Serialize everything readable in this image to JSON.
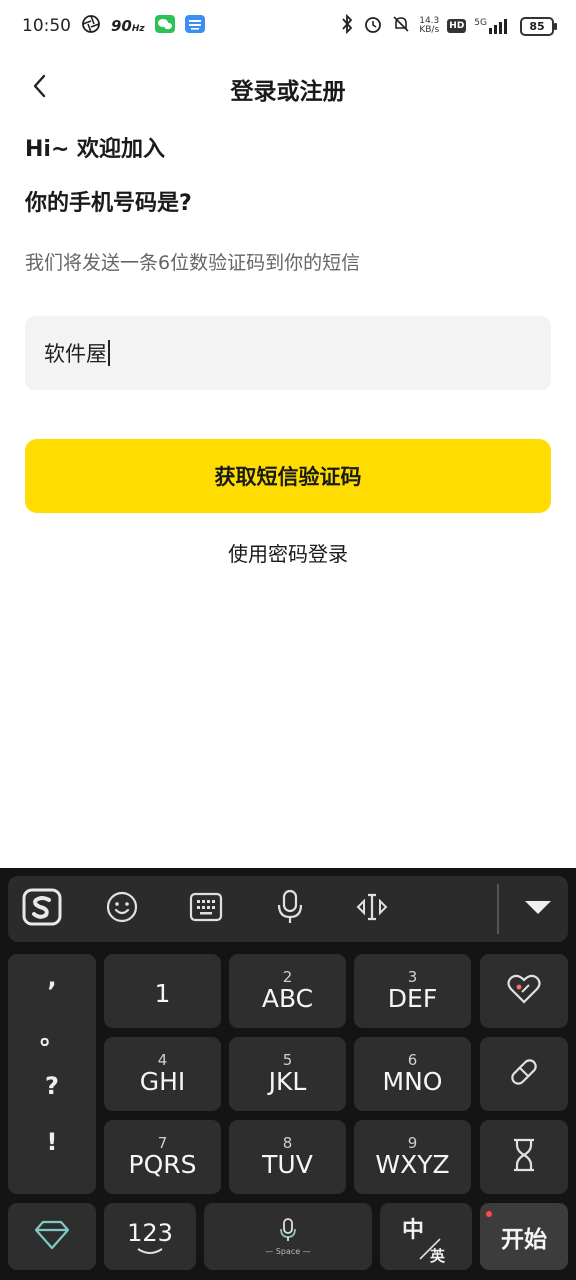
{
  "status_bar": {
    "time": "10:50",
    "refresh_rate": "90",
    "refresh_unit": "Hz",
    "net_speed_value": "14.3",
    "net_speed_unit": "KB/s",
    "hd_label": "HD",
    "network_label": "5G",
    "battery": "85"
  },
  "header": {
    "title": "登录或注册"
  },
  "main": {
    "greeting": "Hi~ 欢迎加入",
    "question": "你的手机号码是?",
    "hint": "我们将发送一条6位数验证码到你的短信",
    "phone_input_value": "软件屋",
    "get_code_label": "获取短信验证码",
    "password_login_label": "使用密码登录"
  },
  "keyboard": {
    "punctuation": [
      ",",
      "。",
      "?",
      "!"
    ],
    "rows": [
      [
        {
          "num": "",
          "main": "1"
        },
        {
          "num": "2",
          "main": "ABC"
        },
        {
          "num": "3",
          "main": "DEF"
        }
      ],
      [
        {
          "num": "4",
          "main": "GHI"
        },
        {
          "num": "5",
          "main": "JKL"
        },
        {
          "num": "6",
          "main": "MNO"
        }
      ],
      [
        {
          "num": "7",
          "main": "PQRS"
        },
        {
          "num": "8",
          "main": "TUV"
        },
        {
          "num": "9",
          "main": "WXYZ"
        }
      ]
    ],
    "numbers_key": "123",
    "space_label": "Space",
    "lang_top": "中",
    "lang_bottom": "英",
    "start_key": "开始"
  },
  "colors": {
    "accent": "#ffdd00",
    "input_bg": "#f3f3f3",
    "keyboard_bg": "#141414",
    "key_bg": "#2e2e2e"
  },
  "icons": [
    "back-arrow-icon",
    "sogou-logo-icon",
    "emoji-icon",
    "keyboard-icon",
    "microphone-icon",
    "cursor-move-icon",
    "collapse-keyboard-icon",
    "heart-tag-icon",
    "pill-icon",
    "hourglass-icon",
    "gem-icon"
  ]
}
